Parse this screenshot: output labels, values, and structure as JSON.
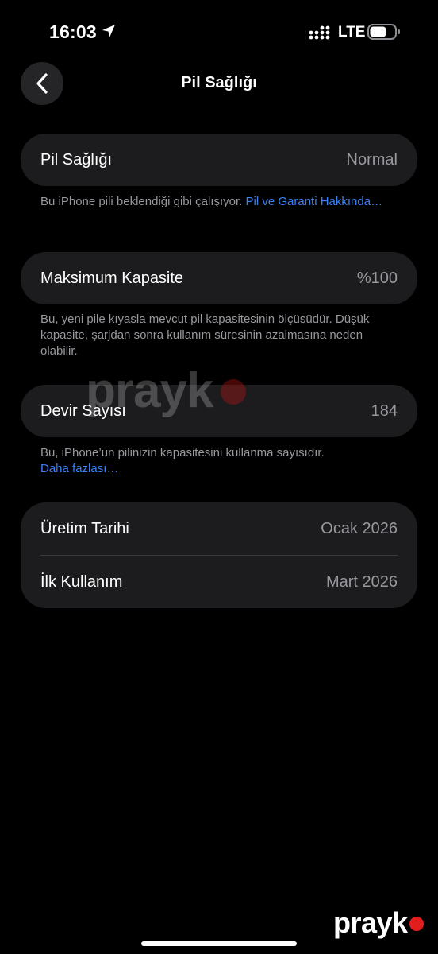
{
  "status_bar": {
    "time": "16:03",
    "network": "LTE"
  },
  "nav": {
    "title": "Pil Sağlığı"
  },
  "battery_health": {
    "label": "Pil Sağlığı",
    "value": "Normal",
    "footnote": "Bu iPhone pili beklendiği gibi çalışıyor.",
    "footnote_link": "Pil ve Garanti Hakkında…"
  },
  "max_capacity": {
    "label": "Maksimum Kapasite",
    "value": "%100",
    "footnote": "Bu, yeni pile kıyasla mevcut pil kapasitesinin ölçüsüdür. Düşük kapasite, şarjdan sonra kullanım süresinin azalmasına neden olabilir."
  },
  "cycle_count": {
    "label": "Devir Sayısı",
    "value": "184",
    "footnote": "Bu, iPhone’un pilinizin kapasitesini kullanma sayısıdır.",
    "footnote_link": "Daha fazlası…"
  },
  "dates": {
    "manufacture_label": "Üretim Tarihi",
    "manufacture_value": "Ocak 2026",
    "first_use_label": "İlk Kullanım",
    "first_use_value": "Mart 2026"
  },
  "watermark": {
    "text": "prayk"
  },
  "colors": {
    "background": "#000000",
    "card": "#1c1c1e",
    "secondary_text": "#98989e",
    "link": "#3b82f6"
  }
}
